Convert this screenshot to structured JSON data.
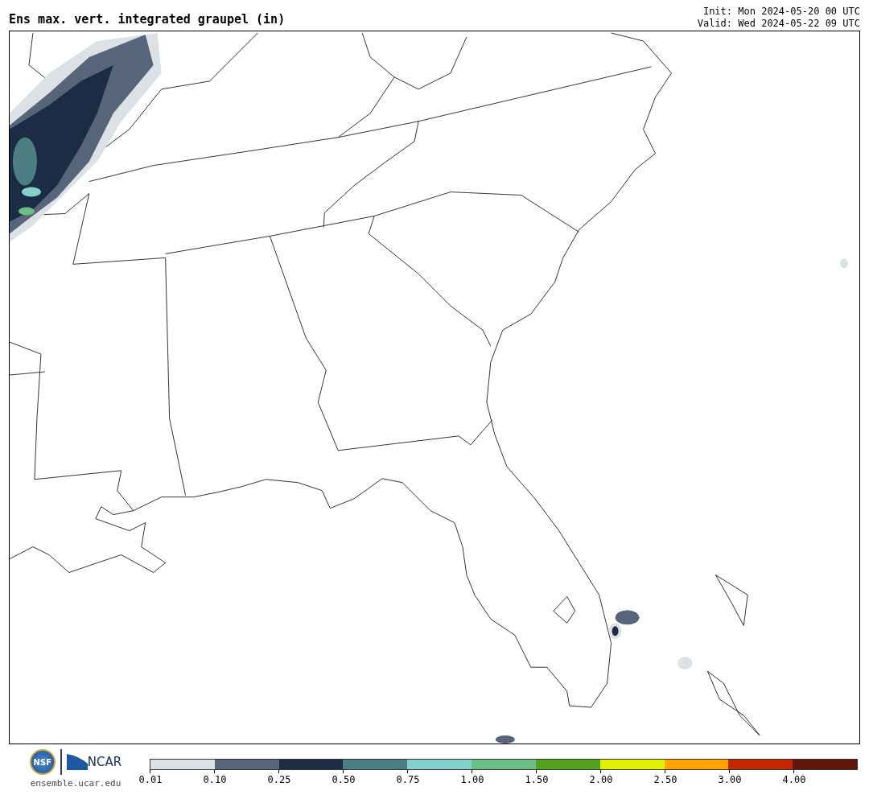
{
  "title": "Ens max. vert. integrated graupel (in)",
  "init": "Init: Mon 2024-05-20 00 UTC",
  "valid": "Valid: Wed 2024-05-22 09 UTC",
  "logos": {
    "nsf": "NSF",
    "ncar": "NCAR",
    "url": "ensemble.ucar.edu"
  },
  "legend": [
    {
      "label": "0.01",
      "color": "#dce1e5"
    },
    {
      "label": "0.10",
      "color": "#56657a"
    },
    {
      "label": "0.25",
      "color": "#1b2c44"
    },
    {
      "label": "0.50",
      "color": "#4c7f83"
    },
    {
      "label": "0.75",
      "color": "#84cfc8"
    },
    {
      "label": "1.00",
      "color": "#6bbf85"
    },
    {
      "label": "1.50",
      "color": "#53a321"
    },
    {
      "label": "2.00",
      "color": "#e1f200"
    },
    {
      "label": "2.50",
      "color": "#ffa300"
    },
    {
      "label": "3.00",
      "color": "#c32700"
    },
    {
      "label": "4.00",
      "color": "#61160b"
    }
  ]
}
